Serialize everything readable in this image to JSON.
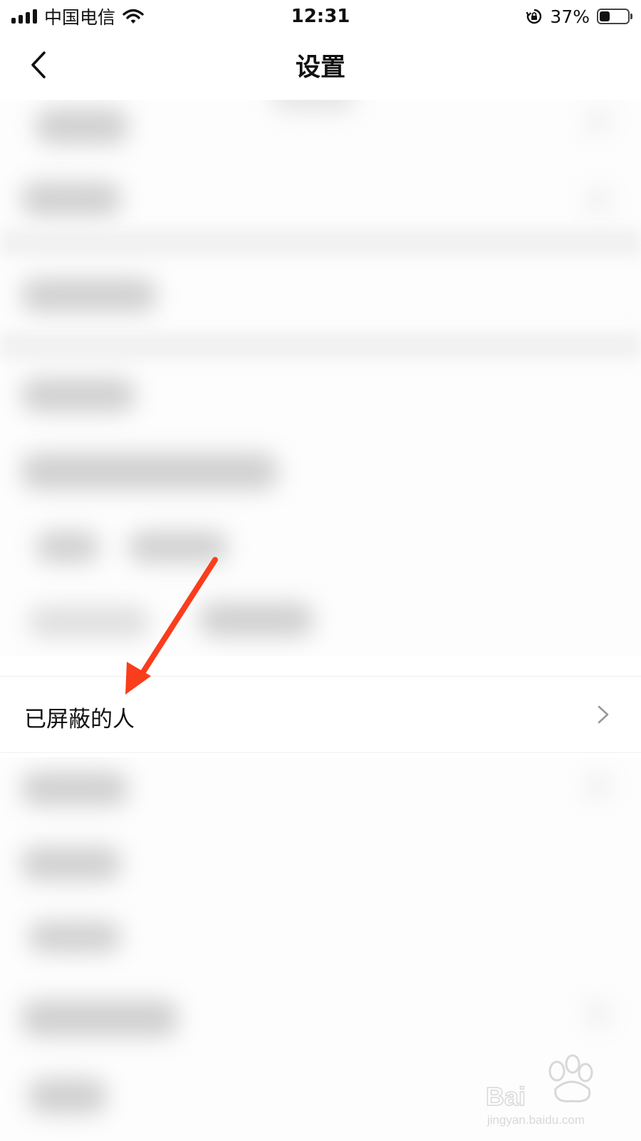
{
  "status_bar": {
    "carrier": "中国电信",
    "time": "12:31",
    "battery_percent_text": "37%",
    "battery_level": 0.37,
    "icons": [
      "signal-icon",
      "wifi-icon",
      "rotation-lock-icon",
      "battery-icon"
    ]
  },
  "nav": {
    "title": "设置",
    "back_icon": "chevron-left-icon"
  },
  "highlighted_row": {
    "label": "已屏蔽的人",
    "chevron_icon": "chevron-right-icon"
  },
  "annotation": {
    "arrow_color": "#fa3d1c"
  },
  "watermark": {
    "brand": "Baidu经验",
    "url": "jingyan.baidu.com"
  }
}
